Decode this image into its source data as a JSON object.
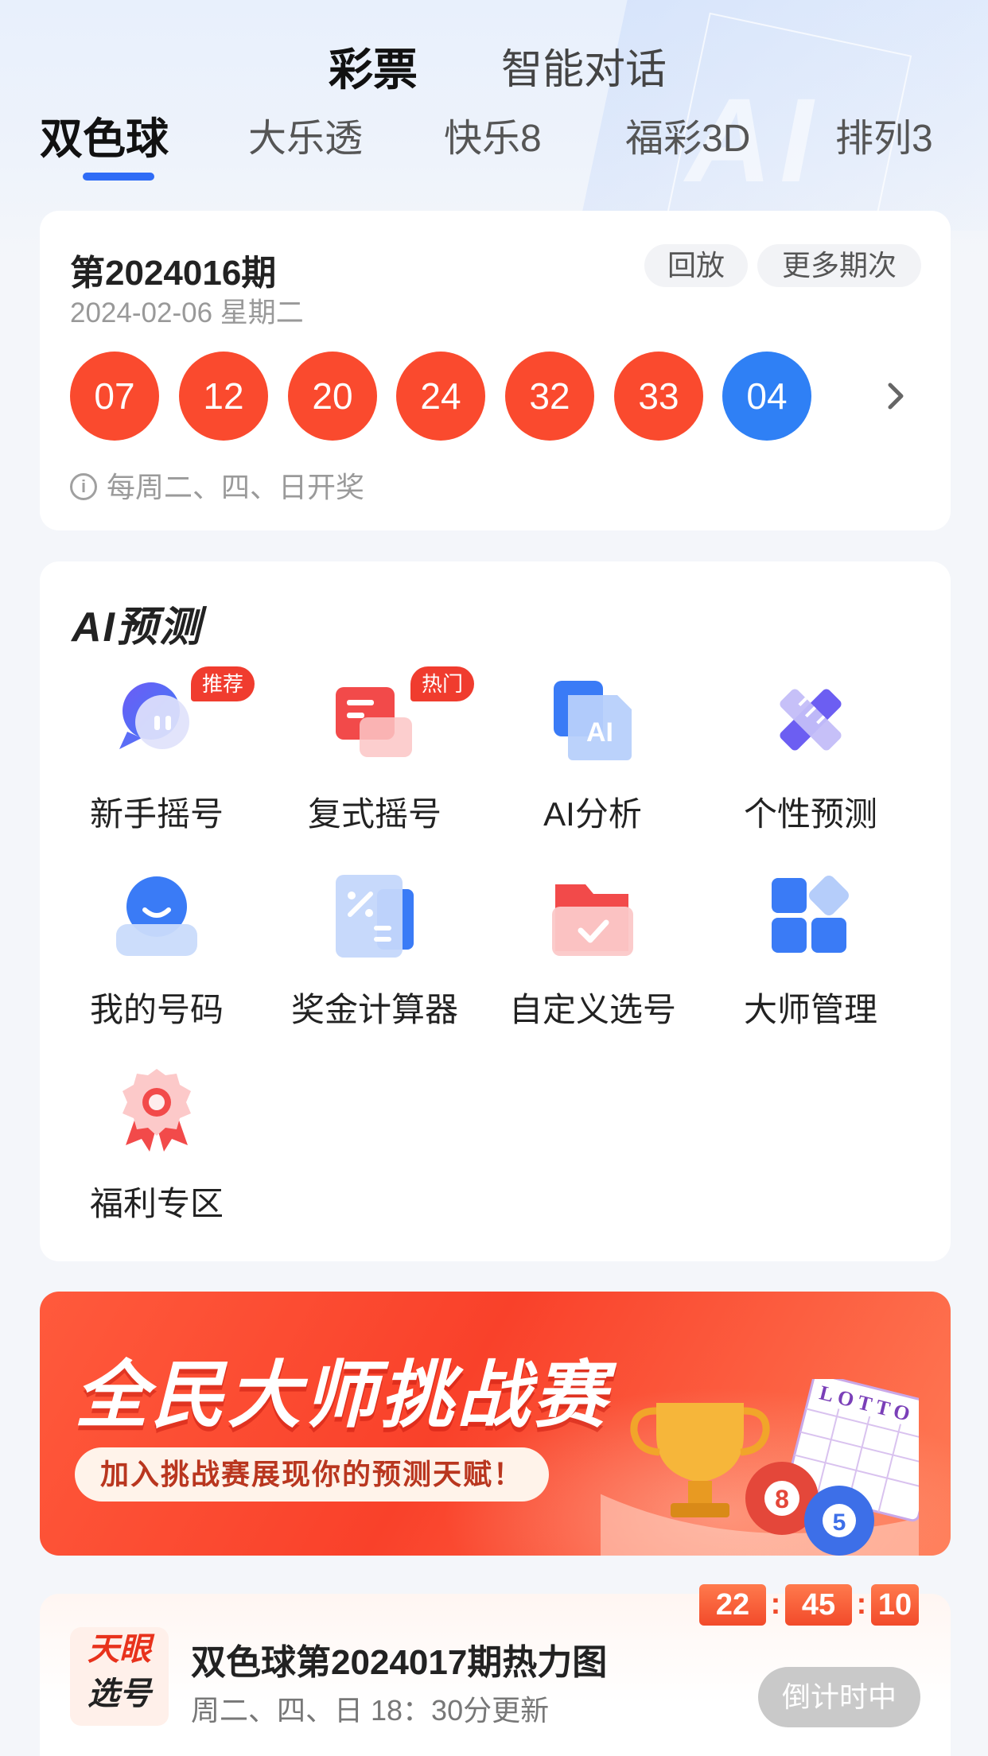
{
  "main_tabs": [
    {
      "label": "彩票",
      "active": true
    },
    {
      "label": "智能对话",
      "active": false
    }
  ],
  "lottery_tabs": [
    {
      "label": "双色球",
      "active": true
    },
    {
      "label": "大乐透",
      "active": false
    },
    {
      "label": "快乐8",
      "active": false
    },
    {
      "label": "福彩3D",
      "active": false
    },
    {
      "label": "排列3",
      "active": false
    }
  ],
  "draw": {
    "issue": "第2024016期",
    "date": "2024-02-06 星期二",
    "replay_label": "回放",
    "more_label": "更多期次",
    "red_balls": [
      "07",
      "12",
      "20",
      "24",
      "32",
      "33"
    ],
    "blue_ball": "04",
    "schedule": "每周二、四、日开奖"
  },
  "ai": {
    "title": "AI预测",
    "items": [
      {
        "label": "新手摇号",
        "icon": "chat-bubble-icon",
        "tag": "推荐"
      },
      {
        "label": "复式摇号",
        "icon": "ticket-card-icon",
        "tag": "热门"
      },
      {
        "label": "AI分析",
        "icon": "ai-document-icon",
        "icon_text": "AI"
      },
      {
        "label": "个性预测",
        "icon": "ruler-pencil-icon"
      },
      {
        "label": "我的号码",
        "icon": "smiley-user-icon"
      },
      {
        "label": "奖金计算器",
        "icon": "calculator-icon"
      },
      {
        "label": "自定义选号",
        "icon": "folder-check-icon"
      },
      {
        "label": "大师管理",
        "icon": "grid-blocks-icon"
      },
      {
        "label": "福利专区",
        "icon": "award-badge-icon"
      }
    ]
  },
  "banner": {
    "title": "全民大师挑战赛",
    "subtitle": "加入挑战赛展现你的预测天赋！",
    "ticket_text": "LOTTO",
    "ball1": "8",
    "ball2": "5"
  },
  "heatmap": {
    "logo_line1": "天眼",
    "logo_line2": "选号",
    "title": "双色球第2024017期热力图",
    "subtitle": "周二、四、日 18：30分更新",
    "countdown": {
      "h": "22",
      "m": "45",
      "s": "10",
      "sep": ":"
    },
    "status_label": "倒计时中"
  },
  "colors": {
    "accent_blue": "#2f6cf6",
    "red_ball": "#fa4a2e",
    "blue_ball": "#2f80f5",
    "tag_red": "#f03c2e"
  }
}
